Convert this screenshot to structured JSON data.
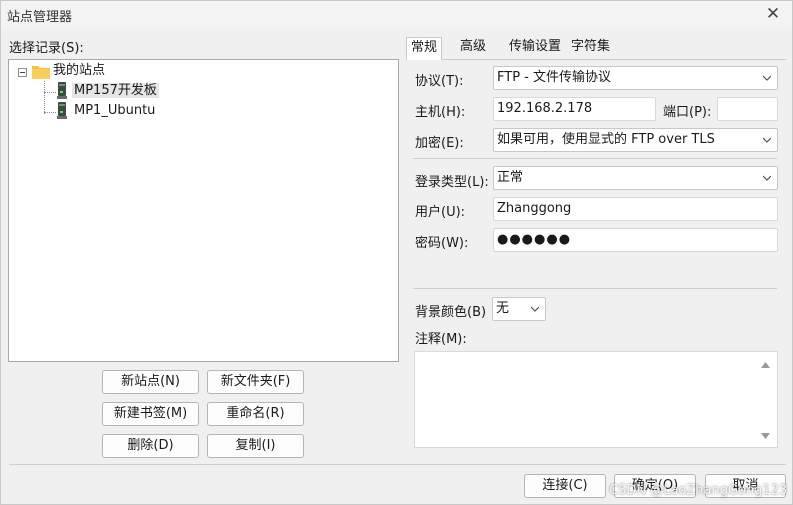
{
  "window": {
    "title": "站点管理器",
    "close_icon": "close-icon"
  },
  "tree": {
    "label": "选择记录(S):",
    "root": "我的站点",
    "items": [
      "MP157开发板",
      "MP1_Ubuntu"
    ]
  },
  "left_buttons": {
    "new_site": "新站点(N)",
    "new_folder": "新文件夹(F)",
    "new_bookmark": "新建书签(M)",
    "rename": "重命名(R)",
    "delete": "删除(D)",
    "copy": "复制(I)"
  },
  "tabs": [
    "常规",
    "高级",
    "传输设置",
    "字符集"
  ],
  "general": {
    "protocol_label": "协议(T):",
    "protocol_value": "FTP - 文件传输协议",
    "host_label": "主机(H):",
    "host_value": "192.168.2.178",
    "port_label": "端口(P):",
    "port_value": "",
    "encryption_label": "加密(E):",
    "encryption_value": "如果可用，使用显式的 FTP over TLS",
    "logon_type_label": "登录类型(L):",
    "logon_type_value": "正常",
    "user_label": "用户(U):",
    "user_value": "Zhanggong",
    "password_label": "密码(W):",
    "password_value": "●●●●●●",
    "bg_color_label": "背景颜色(B)",
    "bg_color_value": "无",
    "notes_label": "注释(M):",
    "notes_value": ""
  },
  "footer": {
    "connect": "连接(C)",
    "ok": "确定(O)",
    "cancel": "取消"
  },
  "watermark": "CSDN @LaoZhangGong123",
  "colors": {
    "folder": "#f5c242",
    "window_bg": "#f0f0f0"
  }
}
